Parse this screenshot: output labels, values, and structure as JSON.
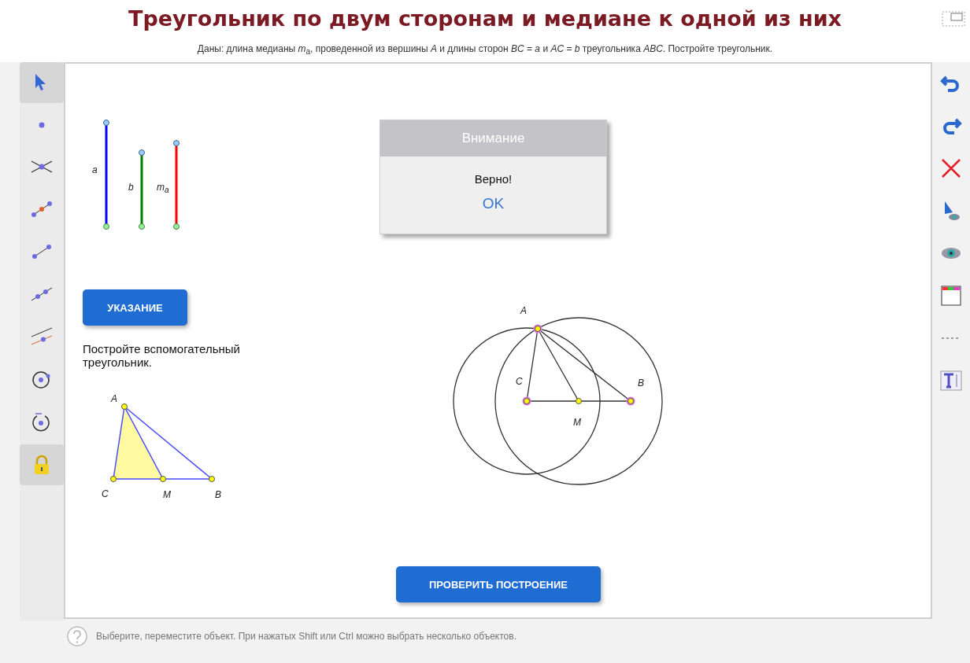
{
  "title": "Треугольник по двум сторонам и медиане к одной из них",
  "description": "Даны: длина медианы *m*$_{a}$, проведенной из вершины *A* и длины сторон *BC* = *a* и *AC* = *b* треугольника *ABC*. Постройте треугольник.",
  "left_toolbar": [
    {
      "kind": "move",
      "selected": true
    },
    {
      "kind": "point",
      "selected": false
    },
    {
      "kind": "intersect",
      "selected": false
    },
    {
      "kind": "midpoint",
      "selected": false
    },
    {
      "kind": "segment",
      "selected": false
    },
    {
      "kind": "line",
      "selected": false
    },
    {
      "kind": "parallel",
      "selected": false
    },
    {
      "kind": "circle",
      "selected": false
    },
    {
      "kind": "compass",
      "selected": false
    },
    {
      "kind": "lock",
      "selected": true
    }
  ],
  "canvas": {
    "segments": [
      {
        "label": "a",
        "color": "#0000ff"
      },
      {
        "label": "b",
        "color": "#008000"
      },
      {
        "label": "m$_{a}$",
        "color": "#ff0000"
      }
    ],
    "hint_button": "УКАЗАНИЕ",
    "hint_text": "Постройте вспомогательный треугольник.",
    "aux_triangle": {
      "labels": [
        "A",
        "C",
        "M",
        "B"
      ]
    },
    "construction": {
      "labels": [
        "A",
        "C",
        "B",
        "M"
      ]
    },
    "dialog": {
      "title": "Внимание",
      "message": "Верно!",
      "button": "OK"
    },
    "check_button": "ПРОВЕРИТЬ ПОСТРОЕНИЕ"
  },
  "right_toolbar": [
    {
      "kind": "undo"
    },
    {
      "kind": "redo"
    },
    {
      "kind": "delete"
    },
    {
      "kind": "show-object"
    },
    {
      "kind": "show-label"
    },
    {
      "kind": "color"
    },
    {
      "kind": "line-style"
    },
    {
      "kind": "text-style"
    }
  ],
  "status_bar": "Выберите, переместите объект. При нажатых Shift или Ctrl можно выбрать несколько объектов."
}
